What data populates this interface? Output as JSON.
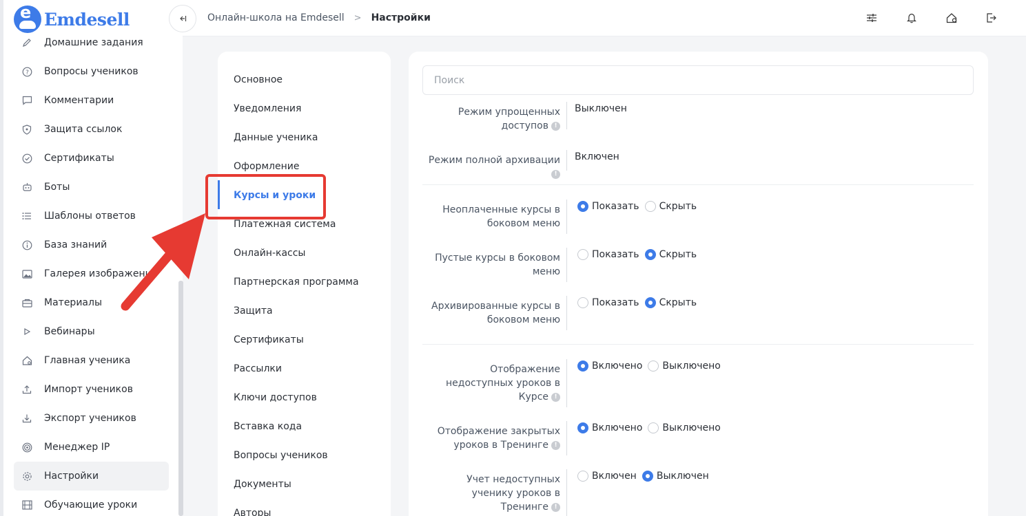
{
  "app": {
    "brand_letter": "e",
    "brand_name": "Emdesell"
  },
  "sidebar": {
    "items": [
      {
        "label": "Домашние задания",
        "icon": "pencil-icon"
      },
      {
        "label": "Вопросы учеников",
        "icon": "question-icon"
      },
      {
        "label": "Комментарии",
        "icon": "comment-icon"
      },
      {
        "label": "Защита ссылок",
        "icon": "shield-icon"
      },
      {
        "label": "Сертификаты",
        "icon": "certificate-icon"
      },
      {
        "label": "Боты",
        "icon": "bot-icon"
      },
      {
        "label": "Шаблоны ответов",
        "icon": "list-icon"
      },
      {
        "label": "База знаний",
        "icon": "info-icon"
      },
      {
        "label": "Галерея изображений",
        "icon": "image-icon"
      },
      {
        "label": "Материалы",
        "icon": "folder-icon"
      },
      {
        "label": "Вебинары",
        "icon": "play-icon"
      },
      {
        "label": "Главная ученика",
        "icon": "home-icon"
      },
      {
        "label": "Импорт учеников",
        "icon": "upload-icon"
      },
      {
        "label": "Экспорт учеников",
        "icon": "download-icon"
      },
      {
        "label": "Менеджер IP",
        "icon": "target-icon"
      },
      {
        "label": "Настройки",
        "icon": "gear-icon",
        "active": true
      },
      {
        "label": "Обучающие уроки",
        "icon": "film-icon"
      }
    ]
  },
  "header": {
    "breadcrumb": [
      "Онлайн-школа на Emdesell",
      "Настройки"
    ],
    "icons": [
      "sliders-icon",
      "bell-icon",
      "home-gear-icon",
      "logout-icon"
    ]
  },
  "settings_menu": {
    "items": [
      "Основное",
      "Уведомления",
      "Данные ученика",
      "Оформление",
      "Курсы и уроки",
      "Платежная система",
      "Онлайн-кассы",
      "Партнерская программа",
      "Защита",
      "Сертификаты",
      "Рассылки",
      "Ключи доступов",
      "Вставка кода",
      "Вопросы учеников",
      "Документы",
      "Авторы"
    ],
    "active": "Курсы и уроки"
  },
  "content": {
    "search_placeholder": "Поиск",
    "rows": {
      "simple_access": {
        "label": "Режим упрощенных доступов",
        "value": "Выключен"
      },
      "full_archive": {
        "label": "Режим полной архивации",
        "value": "Включен"
      },
      "unpaid": {
        "label": "Неоплаченные курсы в боковом меню",
        "opt1": "Показать",
        "opt2": "Скрыть",
        "selected": 1
      },
      "empty": {
        "label": "Пустые курсы в боковом меню",
        "opt1": "Показать",
        "opt2": "Скрыть",
        "selected": 2
      },
      "archived": {
        "label": "Архивированные курсы в боковом меню",
        "opt1": "Показать",
        "opt2": "Скрыть",
        "selected": 2
      },
      "unavailable_lessons": {
        "label": "Отображение недоступных уроков в Курсе",
        "opt1": "Включено",
        "opt2": "Выключено",
        "selected": 1
      },
      "closed_lessons": {
        "label": "Отображение закрытых уроков в Тренинге",
        "opt1": "Включено",
        "opt2": "Выключено",
        "selected": 1
      },
      "count_unavailable": {
        "label": "Учет недоступных ученику уроков в Тренинге",
        "opt1": "Включен",
        "opt2": "Выключен",
        "selected": 2
      }
    }
  },
  "colors": {
    "accent": "#3d7be8",
    "annotation": "#e63a32"
  }
}
